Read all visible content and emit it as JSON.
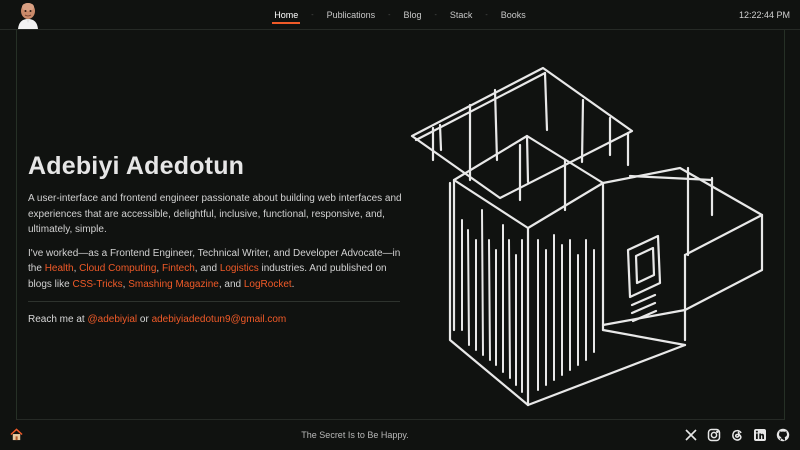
{
  "header": {
    "nav": [
      {
        "label": "Home",
        "active": true
      },
      {
        "label": "Publications",
        "active": false
      },
      {
        "label": "Blog",
        "active": false
      },
      {
        "label": "Stack",
        "active": false
      },
      {
        "label": "Books",
        "active": false
      }
    ],
    "separator": "-",
    "clock": "12:22:44 PM"
  },
  "intro": {
    "name": "Adebiyi Adedotun",
    "bio": "A user-interface and frontend engineer passionate about building web interfaces and experiences that are accessible, delightful, inclusive, functional, responsive, and, ultimately, simple.",
    "work": {
      "lead": "I've worked—as a Frontend Engineer, Technical Writer, and Developer Advocate—in the ",
      "industries": [
        "Health",
        "Cloud Computing",
        "Fintech",
        "Logistics"
      ],
      "sep_1": ", ",
      "sep_2": ", ",
      "sep_3": ", and ",
      "mid": " industries. And published on blogs like ",
      "blogs": [
        "CSS-Tricks",
        "Smashing Magazine",
        "LogRocket"
      ],
      "bsep_1": ", ",
      "bsep_2": ", and ",
      "end": "."
    },
    "reach": {
      "prefix": "Reach me at ",
      "handle": "@adebiyial",
      "or": " or ",
      "email": "adebiyiadedotun9@gmail.com"
    }
  },
  "footer": {
    "tagline": "The Secret Is to Be Happy.",
    "social_icons": [
      "x-icon",
      "instagram-icon",
      "threads-icon",
      "linkedin-icon",
      "github-icon"
    ]
  },
  "colors": {
    "background": "#101210",
    "accent": "#f05a28",
    "text": "#d8d8d8"
  }
}
